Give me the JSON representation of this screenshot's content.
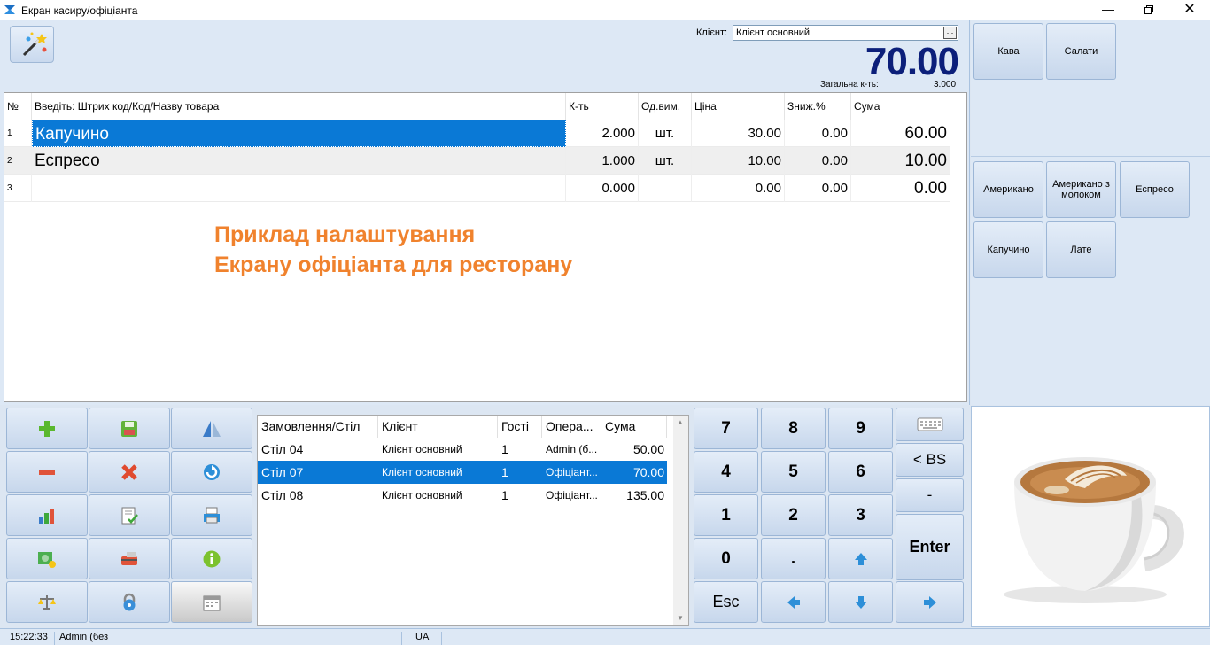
{
  "window": {
    "title": "Екран касиру/офіціанта"
  },
  "header": {
    "client_label": "Клієнт:",
    "client_value": "Клієнт основний",
    "client_button": "...",
    "total": "70.00",
    "total_qty_label": "Загальна к-ть:",
    "total_qty_value": "3.000"
  },
  "grid": {
    "columns": {
      "no": "№",
      "name": "Введіть: Штрих код/Код/Назву товара",
      "qty": "К-ть",
      "unit": "Од.вим.",
      "price": "Ціна",
      "discount": "Зниж.%",
      "sum": "Сума"
    },
    "rows": [
      {
        "no": "1",
        "name": "Капучино",
        "qty": "2.000",
        "unit": "шт.",
        "price": "30.00",
        "discount": "0.00",
        "sum": "60.00"
      },
      {
        "no": "2",
        "name": "Еспресо",
        "qty": "1.000",
        "unit": "шт.",
        "price": "10.00",
        "discount": "0.00",
        "sum": "10.00"
      },
      {
        "no": "3",
        "name": "",
        "qty": "0.000",
        "unit": "",
        "price": "0.00",
        "discount": "0.00",
        "sum": "0.00"
      }
    ]
  },
  "promo": {
    "line1": "Приклад налаштування",
    "line2": "Екрану офіціанта для ресторану"
  },
  "categories": {
    "top": [
      "Кава",
      "Салати"
    ],
    "products": [
      "Американо",
      "Американо з молоком",
      "Еспресо",
      "Капучино",
      "Лате"
    ]
  },
  "orders": {
    "columns": {
      "table": "Замовлення/Стіл",
      "client": "Клієнт",
      "guests": "Гості",
      "operator": "Опера...",
      "sum": "Сума"
    },
    "rows": [
      {
        "table": "Стіл 04",
        "client": "Клієнт основний",
        "guests": "1",
        "operator": "Admin (б...",
        "sum": "50.00"
      },
      {
        "table": "Стіл 07",
        "client": "Клієнт основний",
        "guests": "1",
        "operator": "Офіціант...",
        "sum": "70.00"
      },
      {
        "table": "Стіл 08",
        "client": "Клієнт основний",
        "guests": "1",
        "operator": "Офіціант...",
        "sum": "135.00"
      }
    ]
  },
  "keypad": {
    "k7": "7",
    "k8": "8",
    "k9": "9",
    "k4": "4",
    "k5": "5",
    "k6": "6",
    "k1": "1",
    "k2": "2",
    "k3": "3",
    "k0": "0",
    "dot": ".",
    "esc": "Esc",
    "bs": "< BS",
    "minus": "-",
    "enter": "Enter"
  },
  "status": {
    "time": "15:22:33",
    "user": "Admin (без",
    "lang": "UA"
  },
  "colors": {
    "selection": "#0a79d6",
    "total": "#0c1f7a",
    "promo": "#f0822d"
  }
}
